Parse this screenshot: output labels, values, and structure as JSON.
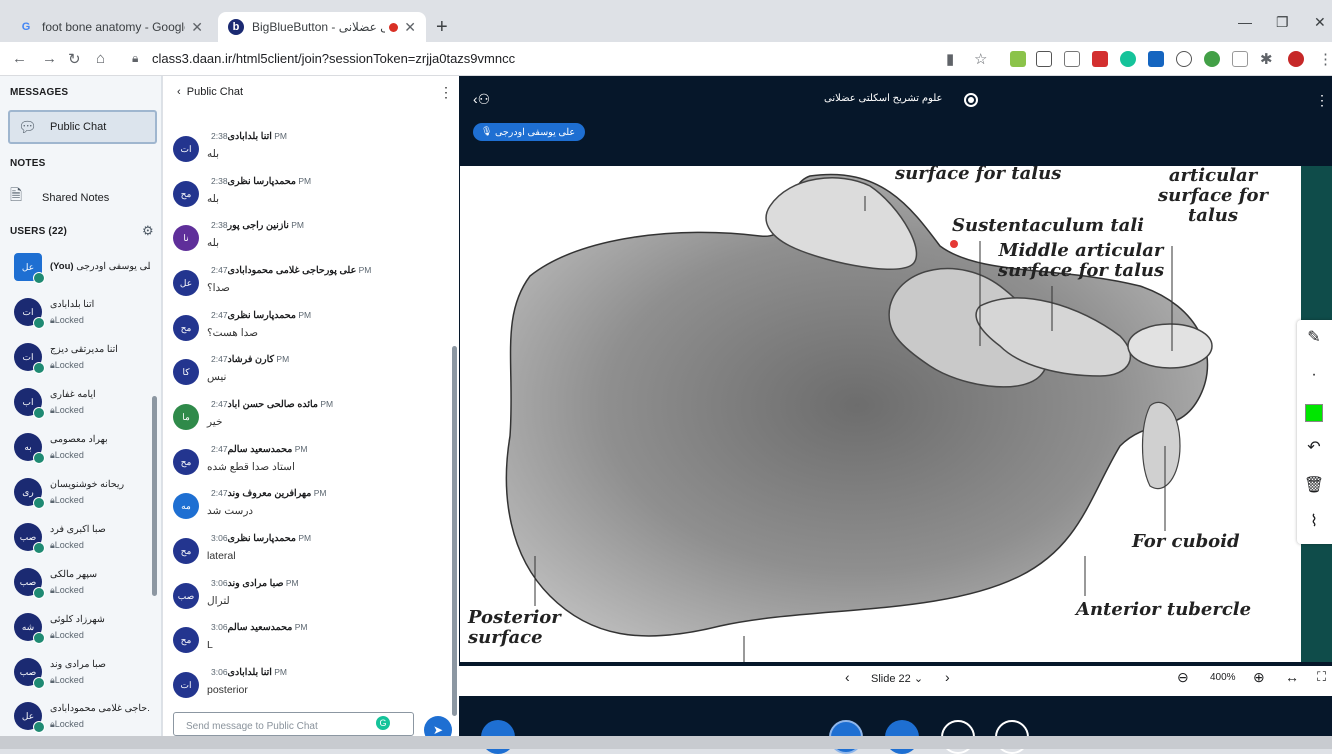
{
  "browser": {
    "tabs": [
      {
        "title": "foot bone anatomy - Google Search",
        "favicon": "G"
      },
      {
        "title": "BigBlueButton - علوم تشریح اسکلتی عضلانی",
        "favicon": "b"
      }
    ],
    "url": "class3.daan.ir/html5client/join?sessionToken=zrjja0tazs9vmncc"
  },
  "sidebar": {
    "messages_heading": "MESSAGES",
    "public_chat_label": "Public Chat",
    "notes_heading": "NOTES",
    "shared_notes_label": "Shared Notes",
    "users_heading": "USERS (22)",
    "users": [
      {
        "initials": "عل",
        "name": "علی یوسفی اودرجی",
        "you": "(You)",
        "status": "",
        "self": true
      },
      {
        "initials": "ات",
        "name": "اتنا بلدابادی",
        "status": "Locked"
      },
      {
        "initials": "ات",
        "name": "اتنا مدیرتقی دیزج",
        "status": "Locked"
      },
      {
        "initials": "اب",
        "name": "ایامه غفاری",
        "status": "Locked"
      },
      {
        "initials": "به",
        "name": "بهراد معصومی",
        "status": "Locked"
      },
      {
        "initials": "ری",
        "name": "ریحانه خوشنویسان",
        "status": "Locked"
      },
      {
        "initials": "صب",
        "name": "صبا اکبری فرد",
        "status": "Locked"
      },
      {
        "initials": "صب",
        "name": "سپهر مالکی",
        "status": "Locked"
      },
      {
        "initials": "شه",
        "name": "شهرزاد کلوئی",
        "status": "Locked"
      },
      {
        "initials": "صب",
        "name": "صبا مرادی وند",
        "status": "Locked"
      },
      {
        "initials": "عل",
        "name": "حاجی غلامی محمودابادی...",
        "status": "Locked"
      }
    ]
  },
  "chat": {
    "title": "Public Chat",
    "input_placeholder": "Send message to Public Chat",
    "messages": [
      {
        "initials": "ات",
        "sender": "اتنا بلدابادی",
        "time": "2:38 PM",
        "text": "بله",
        "color": "dblue"
      },
      {
        "initials": "مح",
        "sender": "محمدپارسا نظری",
        "time": "2:38 PM",
        "text": "بله",
        "color": "dblue"
      },
      {
        "initials": "نا",
        "sender": "نازنین راجی پور",
        "time": "2:38 PM",
        "text": "بله",
        "color": "purple"
      },
      {
        "initials": "عل",
        "sender": "علی پورحاجی غلامی محمودابادی",
        "time": "2:47 PM",
        "text": "صدا؟",
        "color": "dblue"
      },
      {
        "initials": "مح",
        "sender": "محمدپارسا نظری",
        "time": "2:47 PM",
        "text": "صدا هست؟",
        "color": "dblue"
      },
      {
        "initials": "کا",
        "sender": "کارن فرشاد",
        "time": "2:47 PM",
        "text": "نیس",
        "color": "dblue"
      },
      {
        "initials": "ما",
        "sender": "مائده صالحی حسن اباد",
        "time": "2:47 PM",
        "text": "خیر",
        "color": "green"
      },
      {
        "initials": "مح",
        "sender": "محمدسعید سالم",
        "time": "2:47 PM",
        "text": "استاد صدا قطع شده",
        "color": "dblue"
      },
      {
        "initials": "مه",
        "sender": "مهرافرین معروف وند",
        "time": "2:47 PM",
        "text": "درست شد",
        "color": "blue"
      },
      {
        "initials": "مح",
        "sender": "محمدپارسا نظری",
        "time": "3:06 PM",
        "text": "lateral",
        "color": "dblue"
      },
      {
        "initials": "صب",
        "sender": "صبا مرادی وند",
        "time": "3:06 PM",
        "text": "لترال",
        "color": "dblue"
      },
      {
        "initials": "مح",
        "sender": "محمدسعید سالم",
        "time": "3:06 PM",
        "text": "L",
        "color": "dblue"
      },
      {
        "initials": "ات",
        "sender": "اتنا بلدابادی",
        "time": "3:06 PM",
        "text": "posterior",
        "color": "dblue"
      }
    ]
  },
  "presentation": {
    "session_title": "علوم تشریح اسکلتی عضلانی",
    "talker": "علی یوسفی اودرجی",
    "labels": {
      "surface_for_talus": "surface for talus",
      "articular_surface": "articular surface for talus",
      "sustentaculum": "Sustentaculum tali",
      "middle_articular": "Middle articular surface for talus",
      "for_cuboid": "For cuboid",
      "anterior_tubercle": "Anterior tubercle",
      "posterior_surface": "Posterior surface"
    },
    "slide_label": "Slide 22",
    "zoom": "400%"
  }
}
